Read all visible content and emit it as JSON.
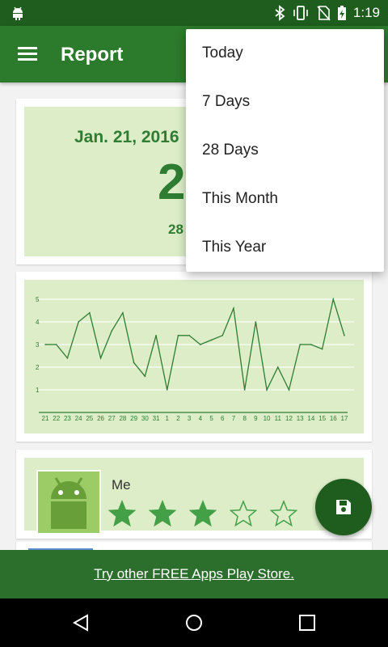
{
  "status_bar": {
    "time": "1:19"
  },
  "app_bar": {
    "title": "Report"
  },
  "summary": {
    "date": "Jan. 21, 2016",
    "big_value": "2",
    "small_value": "28"
  },
  "chart_data": {
    "type": "line",
    "x": [
      "21",
      "22",
      "23",
      "24",
      "25",
      "26",
      "27",
      "28",
      "29",
      "30",
      "31",
      "1",
      "2",
      "3",
      "4",
      "5",
      "6",
      "7",
      "8",
      "9",
      "10",
      "11",
      "12",
      "13",
      "14",
      "15",
      "16",
      "17"
    ],
    "values": [
      3.0,
      3.0,
      2.4,
      4.0,
      4.4,
      2.4,
      3.6,
      4.4,
      2.2,
      1.6,
      3.4,
      1.0,
      3.4,
      3.4,
      3.0,
      3.2,
      3.4,
      4.6,
      1.0,
      4.0,
      1.0,
      2.0,
      1.0,
      3.0,
      3.0,
      2.8,
      5.0,
      3.4
    ],
    "yticks": [
      "1",
      "2",
      "3",
      "4",
      "5"
    ],
    "ylim": [
      0,
      5
    ],
    "color": "#2e7d32"
  },
  "rating": {
    "name": "Me",
    "stars_filled": 3,
    "stars_total": 5
  },
  "banner": {
    "text": "Try other FREE Apps Play Store."
  },
  "dropdown": {
    "items": [
      "Today",
      "7 Days",
      "28 Days",
      "This Month",
      "This Year"
    ]
  }
}
